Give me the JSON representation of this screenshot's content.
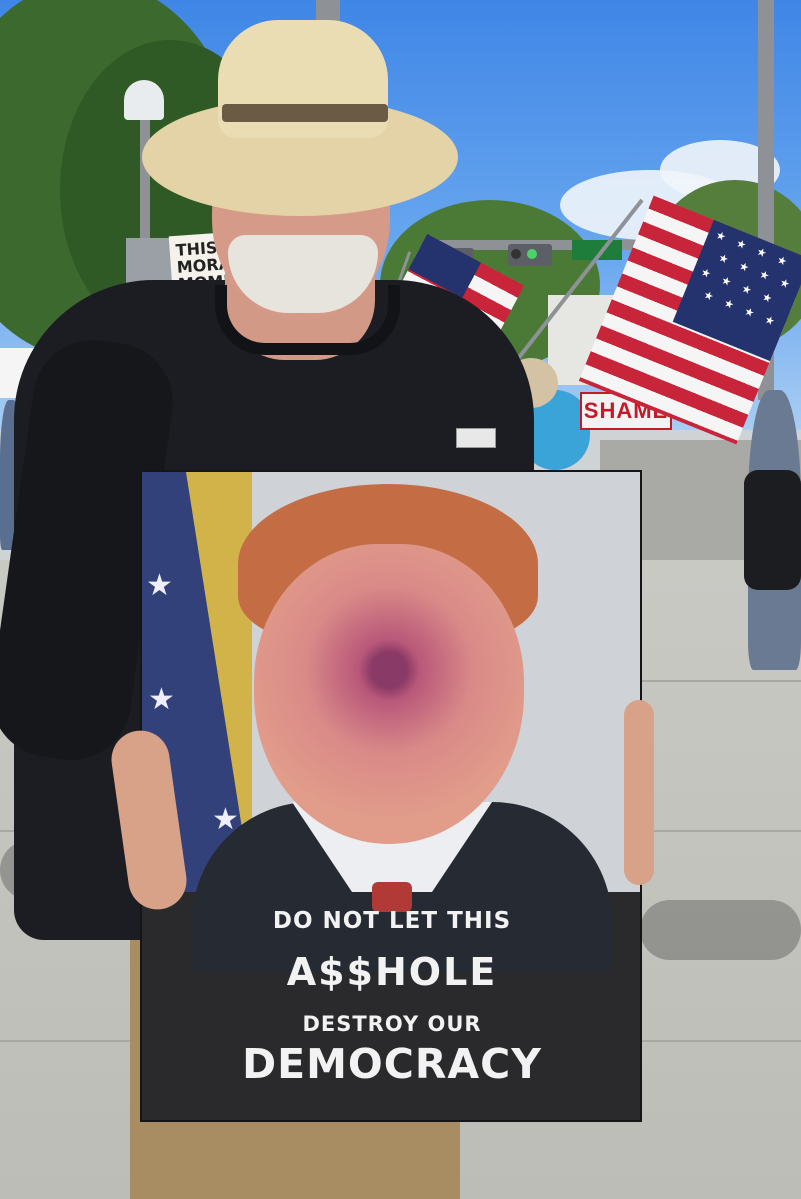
{
  "poster": {
    "line1": "DO NOT LET THIS",
    "line2": "A$$HOLE",
    "line3": "DESTROY OUR",
    "line4": "DEMOCRACY"
  },
  "background_sign": {
    "text": "THIS\nMORAL\nMOMENT\nAMERICA"
  },
  "banner": {
    "text": "SHAME"
  },
  "colors": {
    "sky": "#5a9be9",
    "shirt": "#1b1d22",
    "hat": "#e3d3a6",
    "poster_bg": "#2a2a2d",
    "poster_text": "#f2f2f2",
    "flag_red": "#c8243a",
    "flag_blue": "#24336e"
  }
}
